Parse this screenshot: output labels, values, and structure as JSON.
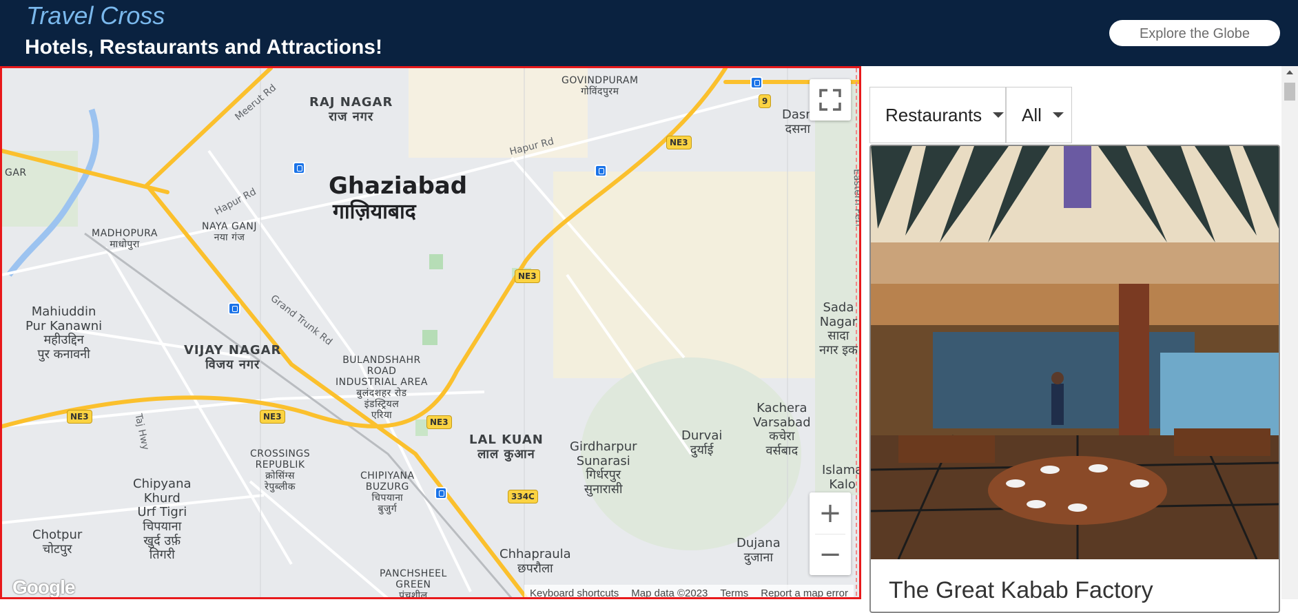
{
  "header": {
    "brand": "Travel Cross",
    "tagline": "Hotels, Restaurants and Attractions!",
    "explore_button": "Explore the Globe"
  },
  "map": {
    "city_en": "Ghaziabad",
    "city_hi": "गाज़ियाबाद",
    "places": {
      "govindpuram": "GOVINDPURAM\nगोविंदपुरम",
      "raj_nagar": "RAJ NAGAR\nराज नगर",
      "madhopura": "MADHOPURA\nमाधोपुरा",
      "naya_ganj": "NAYA GANJ\nनया गंज",
      "mahiuddin": "Mahiuddin\nPur Kanawni\nमहीउद्दिन\nपुर कनावनी",
      "vijay_nagar": "VIJAY NAGAR\nविजय नगर",
      "bulandshahr": "BULANDSHAHR\nROAD\nINDUSTRIAL AREA\nबुलंदशहर रोड\nइंडस्ट्रियल\nएरिया",
      "lal_kuan": "LAL KUAN\nलाल कुआन",
      "girdharpur": "Girdharpur\nSunarasi\nगिर्धरपुर\nसुनारासी",
      "durvai": "Durvai\nदुर्याई",
      "kachera": "Kachera\nVarsabad\nकचेरा\nवर्सबाद",
      "crossings": "CROSSINGS\nREPUBLIK\nक्रोसिंग्स\nरेपुब्लीक",
      "chipyana_buzurg": "CHIPIYANA\nBUZURG\nचिपयाना\nबुजुर्ग",
      "chipyana_khurd": "Chipyana\nKhurd\nUrf Tigri\nचिपयाना\nखुर्द उर्फ़\nतिगरी",
      "chotpur": "Chotpur\nचोटपुर",
      "chhapraula": "Chhapraula\nछपरौला",
      "panchsheel": "PANCHSHEEL\nGREEN\nपंचशील",
      "dujana": "Dujana\nदुजाना",
      "dasna": "Dasn\nदसना",
      "sada_nagar": "Sada\nNagar\nसादा\nनगर इक",
      "islamabad": "Islama\nKalo",
      "gar": "GAR"
    },
    "roads": {
      "meerut_rd": "Meerut Rd",
      "hapur_rd_1": "Hapur Rd",
      "hapur_rd_2": "Hapur Rd",
      "grand_trunk": "Grand Trunk Rd",
      "taj_hwy": "Taj Hwy",
      "eastern_peri": "Eastern Peri"
    },
    "shields": {
      "ne3_a": "NE3",
      "ne3_b": "NE3",
      "ne3_c": "NE3",
      "ne3_d": "NE3",
      "ne3_e": "NE3",
      "r9": "9",
      "r334c": "334C"
    },
    "zoom_in": "+",
    "zoom_out": "−",
    "google": "Google",
    "attribution": {
      "shortcuts": "Keyboard shortcuts",
      "data": "Map data ©2023",
      "terms": "Terms",
      "report": "Report a map error"
    }
  },
  "panel": {
    "category_select": "Restaurants",
    "rating_select": "All",
    "card_title": "The Great Kabab Factory"
  },
  "colors": {
    "header_bg": "#0a2240",
    "brand": "#7ab8ec",
    "map_border": "#e8191b",
    "highway": "#fbc02d"
  }
}
